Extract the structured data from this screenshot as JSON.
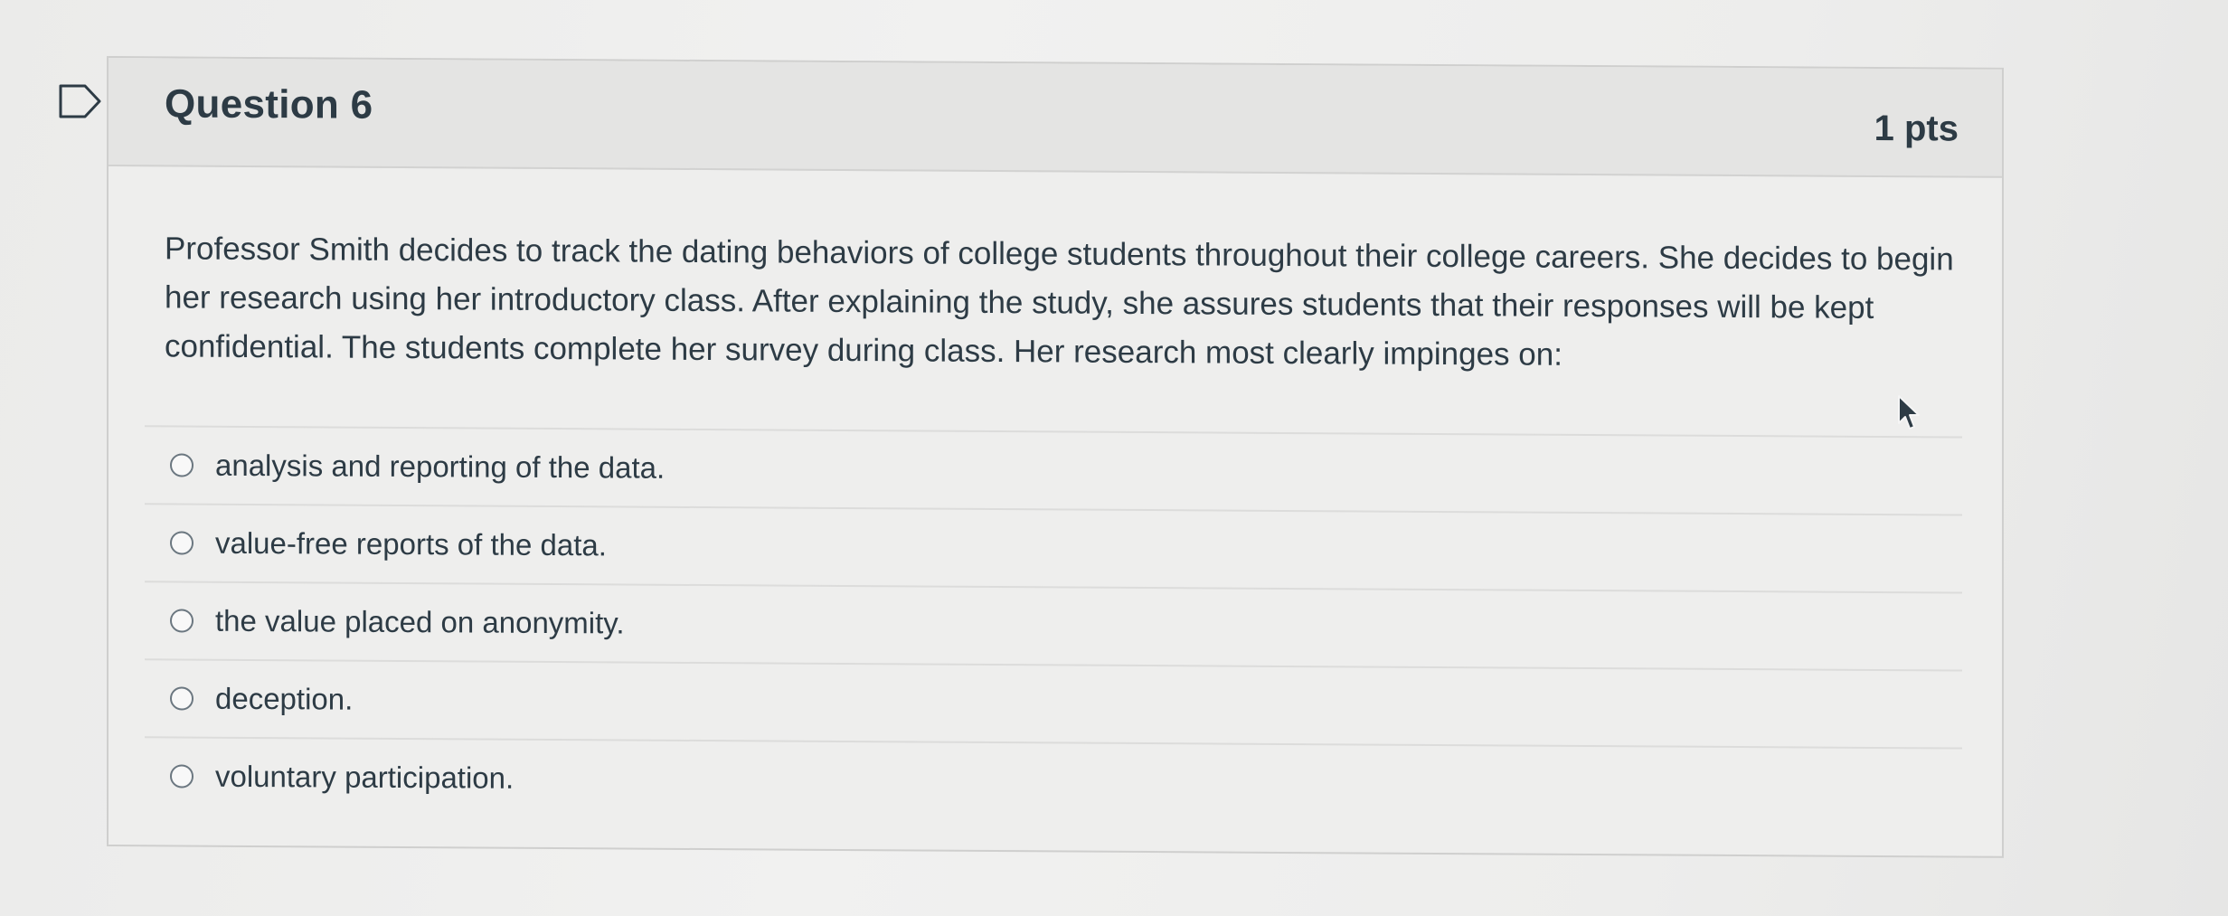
{
  "question": {
    "title": "Question 6",
    "points": "1 pts",
    "text": "Professor Smith decides to track the dating behaviors of college students throughout their college careers. She decides to begin her research using her introductory class. After explaining the study, she assures students that their responses will be kept confidential. The students complete her survey during class. Her research most clearly impinges on:",
    "answers": [
      "analysis and reporting of the data.",
      "value-free reports of the data.",
      "the value placed on anonymity.",
      "deception.",
      "voluntary participation."
    ]
  },
  "icons": {
    "flag": "flag-icon",
    "radio": "radio-button-icon",
    "cursor": "mouse-pointer-icon"
  },
  "colors": {
    "text": "#2d3b45",
    "header_background": "#e4e4e3",
    "border": "#cfcfce"
  }
}
